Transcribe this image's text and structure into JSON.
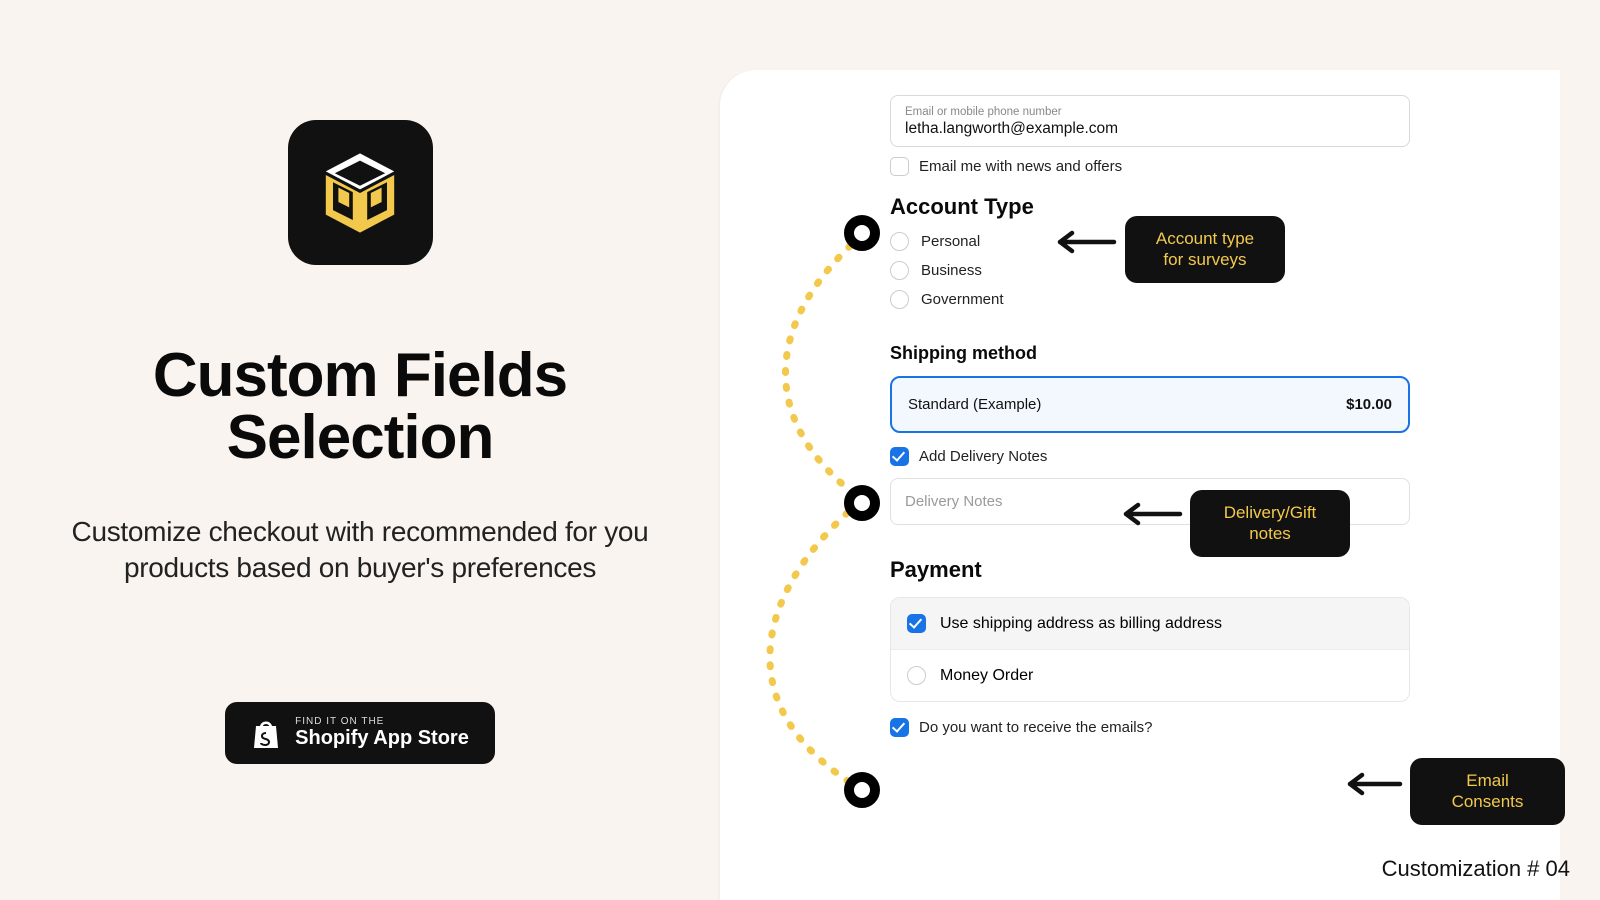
{
  "left": {
    "title_line1": "Custom Fields",
    "title_line2": "Selection",
    "subtitle": "Customize checkout with recommended for you products based on buyer's preferences",
    "store_small": "FIND IT ON THE",
    "store_big": "Shopify App Store"
  },
  "form": {
    "email_label": "Email or mobile phone number",
    "email_value": "letha.langworth@example.com",
    "news_label": "Email me with news and offers",
    "account_title": "Account Type",
    "account_options": {
      "0": "Personal",
      "1": "Business",
      "2": "Government"
    },
    "shipping_title": "Shipping method",
    "shipping_method": "Standard (Example)",
    "shipping_price": "$10.00",
    "delivery_check": "Add Delivery Notes",
    "delivery_placeholder": "Delivery Notes",
    "payment_title": "Payment",
    "billing_label": "Use shipping address as billing address",
    "money_order": "Money Order",
    "emails_label": "Do you want to receive the emails?"
  },
  "callouts": {
    "account": "Account type for surveys",
    "delivery": "Delivery/Gift notes",
    "emails": "Email\nConsents"
  },
  "footer": "Customization # 04"
}
